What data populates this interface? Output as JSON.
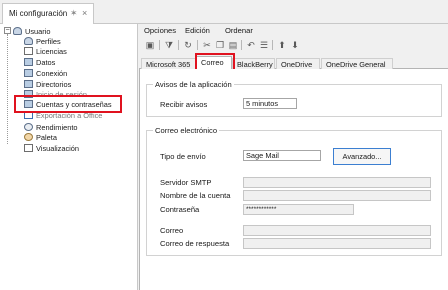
{
  "window": {
    "tab_title": "Mi configuración",
    "pin_icon": "pin-icon",
    "close_icon": "close-icon"
  },
  "tree": {
    "root": "Usuario",
    "items": [
      {
        "label": "Perfiles",
        "icon": "profiles-icon"
      },
      {
        "label": "Licencias",
        "icon": "licenses-icon"
      },
      {
        "label": "Datos",
        "icon": "data-icon"
      },
      {
        "label": "Conexión",
        "icon": "connection-icon"
      },
      {
        "label": "Directorios",
        "icon": "directories-icon"
      },
      {
        "label": "Inicio de sesión",
        "icon": "login-icon"
      },
      {
        "label": "Cuentas y contraseñas",
        "icon": "accounts-icon"
      },
      {
        "label": "Exportación a Office",
        "icon": "office-icon"
      },
      {
        "label": "Rendimiento",
        "icon": "performance-icon"
      },
      {
        "label": "Paleta",
        "icon": "palette-icon"
      },
      {
        "label": "Visualización",
        "icon": "display-icon"
      }
    ],
    "highlight_color": "#e0121f"
  },
  "menubar": {
    "items": [
      "Opciones",
      "Edición",
      "Ordenar"
    ]
  },
  "toolbar": {
    "icons": [
      "save-icon",
      "filter-icon",
      "refresh-icon",
      "cut-icon",
      "copy-icon",
      "paste-icon",
      "undo-icon",
      "properties-icon",
      "move-up-icon",
      "move-down-icon"
    ]
  },
  "tabs": {
    "items": [
      "Microsoft 365",
      "Correo",
      "BlackBerry",
      "OneDrive",
      "OneDrive General"
    ],
    "active": "Correo"
  },
  "avisos": {
    "title": "Avisos de la aplicación",
    "recibir_label": "Recibir avisos",
    "recibir_value": "5 minutos"
  },
  "correo": {
    "title": "Correo electrónico",
    "tipo_label": "Tipo de envío",
    "tipo_value": "Sage Mail",
    "avanzado_label": "Avanzado...",
    "smtp_label": "Servidor SMTP",
    "smtp_value": "",
    "cuenta_label": "Nombre de la cuenta",
    "cuenta_value": "",
    "password_label": "Contraseña",
    "password_value": "************",
    "correo_label": "Correo",
    "correo_value": "",
    "respuesta_label": "Correo de respuesta",
    "respuesta_value": ""
  }
}
